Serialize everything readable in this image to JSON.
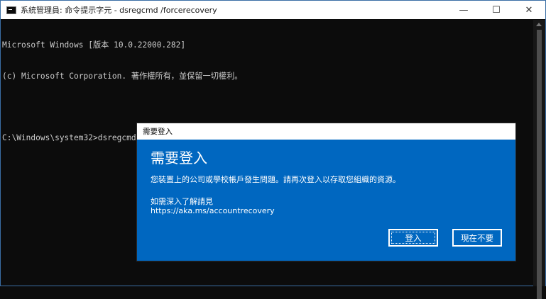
{
  "window": {
    "title": "系統管理員: 命令提示字元 - dsregcmd  /forcerecovery",
    "minimize_glyph": "—",
    "maximize_glyph": "☐",
    "close_glyph": "✕"
  },
  "console": {
    "lines": [
      "Microsoft Windows [版本 10.0.22000.282]",
      "(c) Microsoft Corporation. 著作權所有，並保留一切權利。",
      "",
      "C:\\Windows\\system32>dsregcmd /forcerecovery"
    ]
  },
  "dialog": {
    "titlebar": "需要登入",
    "heading": "需要登入",
    "message": "您裝置上的公司或學校帳戶發生問題。請再次登入以存取您組織的資源。",
    "more_info_label": "如需深入了解請見",
    "link": "https://aka.ms/accountrecovery",
    "signin_button": "登入",
    "notnow_button": "現在不要"
  },
  "colors": {
    "dialog_bg": "#0067c0",
    "console_bg": "#0c0c0c",
    "console_text": "#cccccc"
  },
  "icons": {
    "app": "command-prompt-icon"
  }
}
